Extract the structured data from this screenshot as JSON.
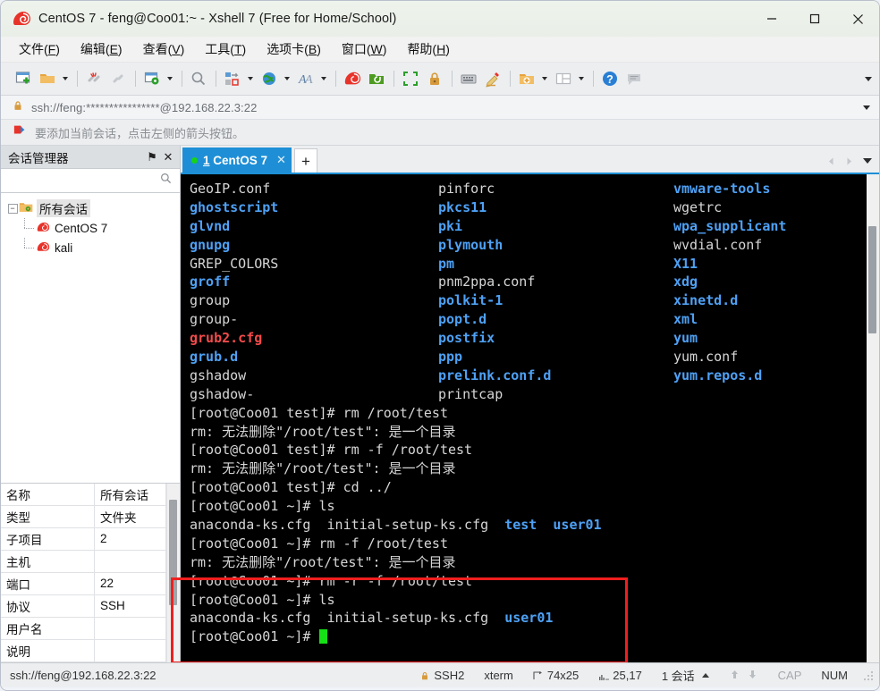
{
  "window": {
    "title": "CentOS 7 - feng@Coo01:~ - Xshell 7 (Free for Home/School)",
    "app_icon": "xshell-snail-icon",
    "minimize_label": "–",
    "maximize_label": "□",
    "close_label": "✕"
  },
  "menubar": {
    "items": [
      {
        "label": "文件(",
        "accel": "F",
        "tail": ")",
        "name": "menu-file"
      },
      {
        "label": "编辑(",
        "accel": "E",
        "tail": ")",
        "name": "menu-edit"
      },
      {
        "label": "查看(",
        "accel": "V",
        "tail": ")",
        "name": "menu-view"
      },
      {
        "label": "工具(",
        "accel": "T",
        "tail": ")",
        "name": "menu-tools"
      },
      {
        "label": "选项卡(",
        "accel": "B",
        "tail": ")",
        "name": "menu-tab"
      },
      {
        "label": "窗口(",
        "accel": "W",
        "tail": ")",
        "name": "menu-window"
      },
      {
        "label": "帮助(",
        "accel": "H",
        "tail": ")",
        "name": "menu-help"
      }
    ]
  },
  "toolbar": {
    "icons": [
      "new-session-icon",
      "open-folder-icon",
      "disconnect-icon",
      "link-icon",
      "session-properties-icon",
      "find-icon",
      "transfer-icon",
      "globe-icon",
      "font-icon",
      "xshell-icon",
      "xftp-icon",
      "fullscreen-icon",
      "lock-icon",
      "keyboard-icon",
      "highlight-icon",
      "add-to-folder-icon",
      "layout-icon",
      "help-icon",
      "chat-icon"
    ],
    "overflow_label": "▼"
  },
  "address": {
    "lock_icon": "lock-icon",
    "value": "ssh://feng:****************@192.168.22.3:22",
    "dropdown_label": "▼"
  },
  "notice": {
    "icon": "arrow-flag-icon",
    "text": "要添加当前会话，点击左侧的箭头按钮。"
  },
  "session_manager": {
    "title": "会话管理器",
    "pin_label": "⚑",
    "close_label": "✕",
    "search_placeholder": "",
    "search_icon": "search-icon",
    "tree": {
      "root": {
        "label": "所有会话",
        "icon": "folder-sessions-icon",
        "expander": "−"
      },
      "children": [
        {
          "label": "CentOS 7",
          "icon": "xshell-session-icon"
        },
        {
          "label": "kali",
          "icon": "xshell-session-icon"
        }
      ]
    },
    "properties": [
      {
        "key": "名称",
        "value": "所有会话"
      },
      {
        "key": "类型",
        "value": "文件夹"
      },
      {
        "key": "子项目",
        "value": "2"
      },
      {
        "key": "主机",
        "value": ""
      },
      {
        "key": "端口",
        "value": "22"
      },
      {
        "key": "协议",
        "value": "SSH"
      },
      {
        "key": "用户名",
        "value": ""
      },
      {
        "key": "说明",
        "value": ""
      }
    ]
  },
  "tabs": {
    "items": [
      {
        "index": "1",
        "label": " CentOS 7",
        "status": "connected",
        "close_label": "✕"
      }
    ],
    "add_label": "+",
    "nav_prev": "◀",
    "nav_next": "▶",
    "nav_menu": "▼"
  },
  "terminal": {
    "columns": [
      [
        "GeoIP.conf",
        "ghostscript",
        "glvnd",
        "gnupg",
        "GREP_COLORS",
        "groff",
        "group",
        "group-",
        "grub2.cfg",
        "grub.d",
        "gshadow",
        "gshadow-"
      ],
      [
        "pinforc",
        "pkcs11",
        "pki",
        "plymouth",
        "pm",
        "pnm2ppa.conf",
        "polkit-1",
        "popt.d",
        "postfix",
        "ppp",
        "prelink.conf.d",
        "printcap"
      ],
      [
        "vmware-tools",
        "wgetrc",
        "wpa_supplicant",
        "wvdial.conf",
        "X11",
        "xdg",
        "xinetd.d",
        "xml",
        "yum",
        "yum.conf",
        "yum.repos.d",
        ""
      ]
    ],
    "column_types": [
      [
        "plain",
        "dir",
        "dir",
        "dir",
        "plain",
        "dir",
        "plain",
        "plain",
        "arc",
        "dir",
        "plain",
        "plain"
      ],
      [
        "plain",
        "dir",
        "dir",
        "dir",
        "dir",
        "plain",
        "dir",
        "dir",
        "dir",
        "dir",
        "dir",
        "plain"
      ],
      [
        "dir",
        "plain",
        "dir",
        "plain",
        "dir",
        "dir",
        "dir",
        "dir",
        "dir",
        "plain",
        "dir",
        "plain"
      ]
    ],
    "lines": [
      {
        "prompt": "[root@Coo01 test]# ",
        "cmd": "rm /root/test"
      },
      {
        "output": "rm: 无法删除\"/root/test\": 是一个目录"
      },
      {
        "prompt": "[root@Coo01 test]# ",
        "cmd": "rm -f /root/test"
      },
      {
        "output": "rm: 无法删除\"/root/test\": 是一个目录"
      },
      {
        "prompt": "[root@Coo01 test]# ",
        "cmd": "cd ../"
      },
      {
        "prompt": "[root@Coo01 ~]# ",
        "cmd": "ls"
      },
      {
        "ls": [
          "anaconda-ks.cfg",
          "initial-setup-ks.cfg",
          "test",
          "user01"
        ],
        "ls_types": [
          "plain",
          "plain",
          "dir",
          "dir"
        ]
      },
      {
        "prompt": "[root@Coo01 ~]# ",
        "cmd": "rm -f /root/test"
      },
      {
        "output": "rm: 无法删除\"/root/test\": 是一个目录"
      },
      {
        "prompt": "[root@Coo01 ~]# ",
        "cmd": "rm -r -f /root/test"
      },
      {
        "prompt": "[root@Coo01 ~]# ",
        "cmd": "ls"
      },
      {
        "ls": [
          "anaconda-ks.cfg",
          "initial-setup-ks.cfg",
          "user01"
        ],
        "ls_types": [
          "plain",
          "plain",
          "dir"
        ]
      },
      {
        "prompt": "[root@Coo01 ~]# ",
        "cmd": "",
        "cursor": true
      }
    ],
    "highlight_color": "#f01f1f"
  },
  "statusbar": {
    "connection": "ssh://feng@192.168.22.3:22",
    "protocol": "SSH2",
    "terminal_type": "xterm",
    "size_icon": "resize-icon",
    "size": "74x25",
    "cursor_icon": "cursor-pos-icon",
    "cursor_pos": "25,17",
    "sessions": "1 会话",
    "sessions_caret": "▲",
    "upload_icon": "upload-arrow-icon",
    "download_icon": "download-arrow-icon",
    "cap": "CAP",
    "num": "NUM"
  },
  "colors": {
    "accent": "#1e8fd6",
    "terminal_bg": "#000000",
    "terminal_dir": "#4ea1f5",
    "terminal_archive": "#f24b4b",
    "terminal_text": "#d6d6d6",
    "cursor": "#16e016",
    "highlight_box": "#f01f1f",
    "tab_active": "#1e8fd6"
  }
}
